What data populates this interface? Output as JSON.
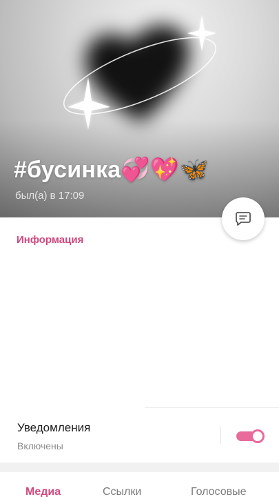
{
  "profile": {
    "name": "#бусинка💞💖🦋",
    "last_seen": "был(а) в 17:09"
  },
  "info": {
    "title": "Информация"
  },
  "notifications": {
    "title": "Уведомления",
    "status": "Включены",
    "enabled": true
  },
  "tabs": [
    {
      "label": "Медиа",
      "active": true
    },
    {
      "label": "Ссылки",
      "active": false
    },
    {
      "label": "Голосовые",
      "active": false
    }
  ],
  "colors": {
    "accent": "#d1497f",
    "toggle": "#e86b9b"
  },
  "icons": {
    "message_button": "message-icon"
  }
}
